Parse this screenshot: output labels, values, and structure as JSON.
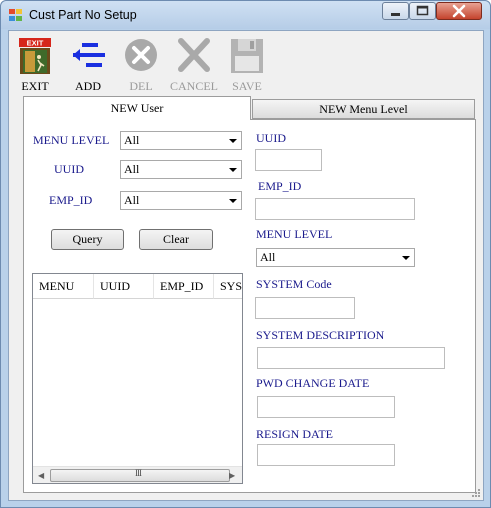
{
  "window": {
    "title": "Cust Part No Setup"
  },
  "toolbar": {
    "exit_label": "EXIT",
    "exit_sign": "EXIT",
    "add_label": "ADD",
    "del_label": "DEL",
    "cancel_label": "CANCEL",
    "save_label": "SAVE"
  },
  "tabs": {
    "new_user": "NEW User",
    "new_menu_level": "NEW Menu Level"
  },
  "filters": {
    "menu_level_label": "MENU LEVEL",
    "menu_level_value": "All",
    "uuid_label": "UUID",
    "uuid_value": "All",
    "emp_id_label": "EMP_ID",
    "emp_id_value": "All",
    "query_button": "Query",
    "clear_button": "Clear"
  },
  "grid": {
    "columns": [
      "MENU",
      "UUID",
      "EMP_ID",
      "SYS"
    ],
    "scroll_grip": "III"
  },
  "form": {
    "uuid_label": "UUID",
    "uuid_value": "",
    "emp_id_label": "EMP_ID",
    "emp_id_value": "",
    "menu_level_label": "MENU LEVEL",
    "menu_level_value": "All",
    "system_code_label": "SYSTEM Code",
    "system_code_value": "",
    "system_description_label": "SYSTEM DESCRIPTION",
    "system_description_value": "",
    "pwd_change_date_label": "PWD CHANGE DATE",
    "pwd_change_date_value": "",
    "resign_date_label": "RESIGN DATE",
    "resign_date_value": ""
  },
  "colors": {
    "label_text": "#1a1a8c",
    "window_frame": "#b9d1ea",
    "close_button": "#c4432d",
    "add_icon": "#1a2fe0",
    "disabled": "#9a9a9a"
  }
}
